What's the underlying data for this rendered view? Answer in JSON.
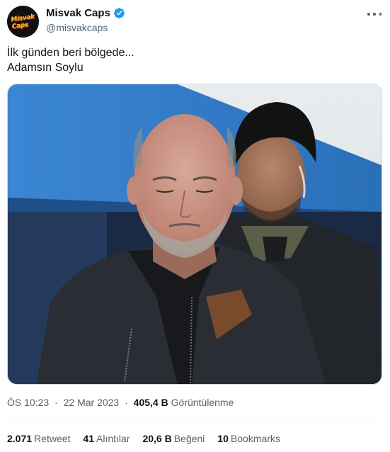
{
  "author": {
    "display_name": "Misvak Caps",
    "handle": "@misvakcaps",
    "verified": true,
    "avatar_logo_text": "Misvak Caps"
  },
  "tweet": {
    "line1": "İlk günden beri bölgede...",
    "line2": "Adamsın Soylu"
  },
  "meta": {
    "time": "ÖS 10:23",
    "date": "22 Mar 2023",
    "views_count": "405,4 B",
    "views_label": "Görüntülenme"
  },
  "stats": {
    "retweets_count": "2.071",
    "retweets_label": "Retweet",
    "quotes_count": "41",
    "quotes_label": "Alıntılar",
    "likes_count": "20,6 B",
    "likes_label": "Beğeni",
    "bookmarks_count": "10",
    "bookmarks_label": "Bookmarks"
  },
  "colors": {
    "verified_blue": "#1d9bf0",
    "text_primary": "#0f1419",
    "text_secondary": "#536471",
    "tent_blue": "#2f7fd0"
  },
  "icons": [
    "verified-badge-icon",
    "more-options-icon"
  ]
}
